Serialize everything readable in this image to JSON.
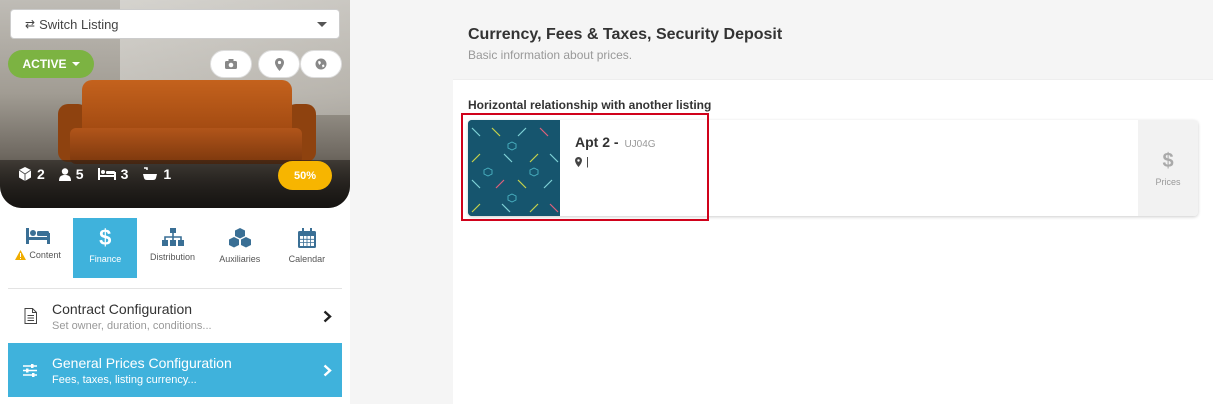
{
  "switch_listing": {
    "label": "Switch Listing"
  },
  "status": {
    "label": "ACTIVE"
  },
  "hero_stats": {
    "units": "2",
    "guests": "5",
    "beds": "3",
    "baths": "1",
    "completion": "50%"
  },
  "tabs": [
    {
      "label": "Content",
      "icon": "bed-icon",
      "warning": true
    },
    {
      "label": "Finance",
      "icon": "dollar-icon",
      "selected": true
    },
    {
      "label": "Distribution",
      "icon": "sitemap-icon"
    },
    {
      "label": "Auxiliaries",
      "icon": "cubes-icon"
    },
    {
      "label": "Calendar",
      "icon": "calendar-icon"
    }
  ],
  "menu": [
    {
      "title": "Contract Configuration",
      "subtitle": "Set owner, duration, conditions...",
      "icon": "document-icon"
    },
    {
      "title": "General Prices Configuration",
      "subtitle": "Fees, taxes, listing currency...",
      "icon": "sliders-icon",
      "selected": true
    }
  ],
  "card": {
    "title": "Currency, Fees & Taxes, Security Deposit",
    "subtitle": "Basic information about prices.",
    "relationship_label": "Horizontal relationship with another listing"
  },
  "listing": {
    "name": "Apt 2",
    "separator": "-",
    "code": "UJ04G",
    "location": "|",
    "prices_label": "Prices",
    "prices_symbol": "$"
  },
  "colors": {
    "accent": "#3fb2dc",
    "active": "#7cb342",
    "badge": "#f7b500",
    "highlight": "#d0021b"
  }
}
